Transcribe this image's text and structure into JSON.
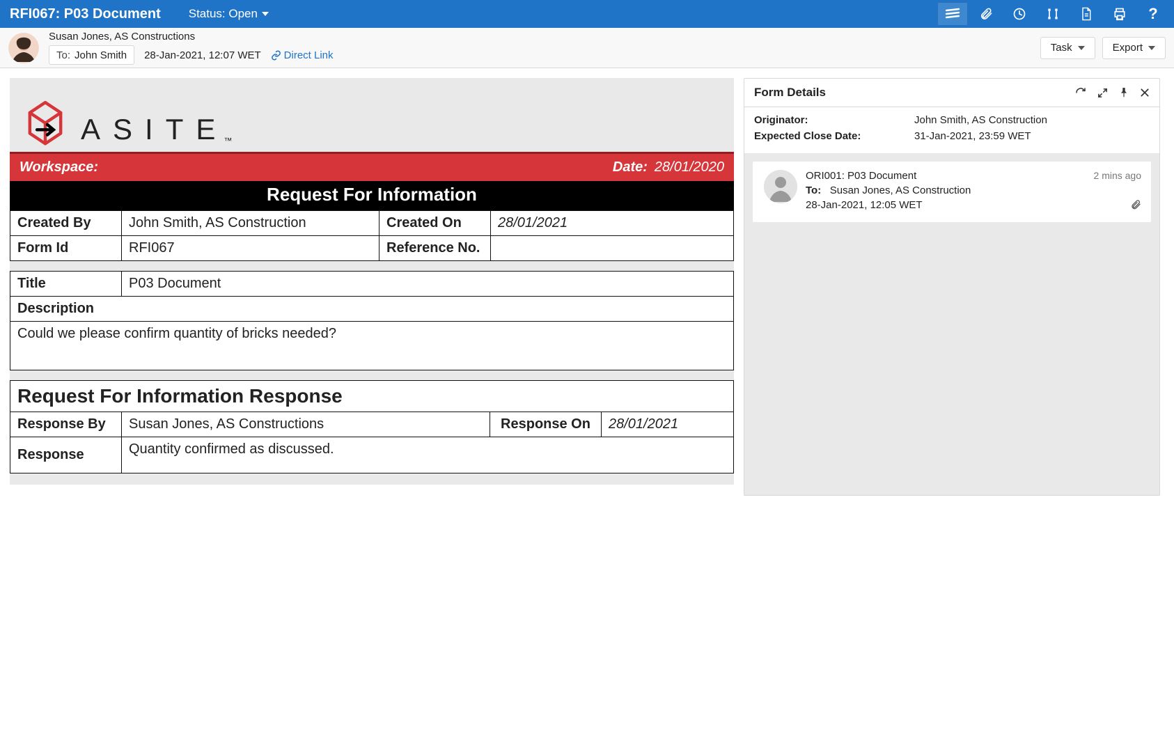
{
  "topbar": {
    "title": "RFI067: P03 Document",
    "status_label": "Status: Open"
  },
  "header": {
    "author": "Susan Jones, AS Constructions",
    "to_label": "To:",
    "to_value": "John Smith",
    "timestamp": "28-Jan-2021, 12:07 WET",
    "direct_link_label": "Direct Link",
    "task_button": "Task",
    "export_button": "Export"
  },
  "form": {
    "workspace_label": "Workspace:",
    "date_label": "Date:",
    "date_value": "28/01/2020",
    "section_title": "Request For Information",
    "created_by_label": "Created By",
    "created_by": "John Smith, AS Construction",
    "created_on_label": "Created On",
    "created_on": "28/01/2021",
    "form_id_label": "Form Id",
    "form_id": "RFI067",
    "reference_no_label": "Reference No.",
    "reference_no": "",
    "title_label": "Title",
    "title": "P03 Document",
    "description_label": "Description",
    "description": "Could we please confirm quantity of bricks needed?",
    "response_section_title": "Request For Information Response",
    "response_by_label": "Response By",
    "response_by": "Susan Jones, AS Constructions",
    "response_on_label": "Response On",
    "response_on": "28/01/2021",
    "response_label": "Response",
    "response": "Quantity confirmed as discussed."
  },
  "details": {
    "panel_title": "Form Details",
    "originator_label": "Originator:",
    "originator": "John Smith, AS Construction",
    "expected_close_label": "Expected Close Date:",
    "expected_close": "31-Jan-2021, 23:59 WET",
    "thread": {
      "title": "ORI001: P03 Document",
      "to_label": "To:",
      "to_value": "Susan Jones, AS Construction",
      "timestamp": "28-Jan-2021, 12:05 WET",
      "age": "2 mins ago"
    }
  }
}
